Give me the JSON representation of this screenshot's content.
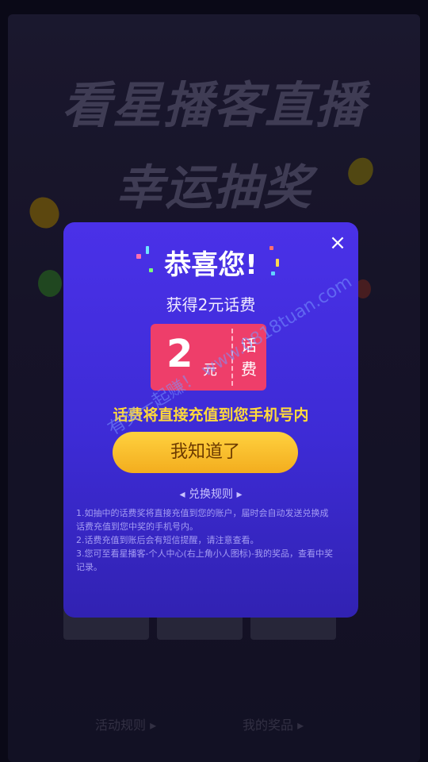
{
  "background": {
    "title_line1": "看星播客直播",
    "title_line2": "幸运抽奖",
    "bottom_link_left": "活动规则 ▸",
    "bottom_link_right": "我的奖品 ▸"
  },
  "modal": {
    "close_label": "×",
    "title": "恭喜您!",
    "subtitle": "获得2元话费",
    "coupon": {
      "amount": "2",
      "unit": "元",
      "label": "话费"
    },
    "notice": "话费将直接充值到您手机号内",
    "ok_button": "我知道了",
    "rules_title": "◂ 兑换规则 ▸",
    "rules": [
      "1.如抽中的话费奖将直接充值到您的账户，届时会自动发送兑换成话费充值到您中奖的手机号内。",
      "2.话费充值到账后会有短信提醒，请注意查看。",
      "3.您可至看星播客-个人中心(右上角小人图标)-我的奖品，查看中奖记录。"
    ]
  },
  "watermark": "有奖一起赚！ www.0818tuan.com",
  "colors": {
    "modal_top": "#4a31e8",
    "modal_bottom": "#3122b2",
    "coupon": "#ee3e6a",
    "notice": "#ffd93b",
    "button": "#f3ad1e"
  }
}
